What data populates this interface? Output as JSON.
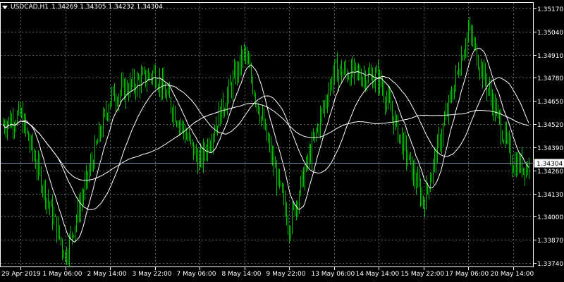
{
  "symbol": "USDCAD",
  "timeframe": "H1",
  "header": {
    "open": "1.34269",
    "high": "1.34305",
    "low": "1.34232",
    "close": "1.34304"
  },
  "current_price_label": "1.34304",
  "colors": {
    "background": "#000000",
    "candles": "#00c000",
    "grid": "#5a6a6a",
    "text": "#ffffff",
    "moving_averages": "#ffffff",
    "price_tag_bg": "#ffffff",
    "price_tag_text": "#000000"
  },
  "icons": {
    "menu": "triangle-down-icon"
  },
  "grid": "dashed",
  "chart_data": {
    "type": "candlestick",
    "instrument": "USDCAD",
    "timeframe": "H1",
    "y_axis": {
      "ticks": [
        "1.35170",
        "1.35040",
        "1.34910",
        "1.34780",
        "1.34650",
        "1.34520",
        "1.34390",
        "1.34260",
        "1.34130",
        "1.34000",
        "1.33870",
        "1.33740"
      ],
      "range": [
        1.3374,
        1.3517
      ]
    },
    "x_axis": {
      "ticks": [
        "29 Apr 2019",
        "1 May 06:00",
        "2 May 14:00",
        "3 May 22:00",
        "7 May 06:00",
        "8 May 14:00",
        "9 May 22:00",
        "13 May 06:00",
        "14 May 14:00",
        "15 May 22:00",
        "17 May 06:00",
        "20 May 14:00"
      ]
    },
    "price_series_approx": [
      [
        "29 Apr 2019",
        1.3457
      ],
      [
        "1 May 06:00",
        1.3378
      ],
      [
        "2 May 14:00",
        1.3467
      ],
      [
        "3 May 22:00",
        1.3481
      ],
      [
        "7 May 06:00",
        1.343
      ],
      [
        "8 May 14:00",
        1.3492
      ],
      [
        "9 May 22:00",
        1.3395
      ],
      [
        "13 May 06:00",
        1.3482
      ],
      [
        "14 May 14:00",
        1.3478
      ],
      [
        "15 May 22:00",
        1.3408
      ],
      [
        "17 May 06:00",
        1.3505
      ],
      [
        "20 May 14:00",
        1.343
      ]
    ],
    "current_price": 1.34304
  }
}
